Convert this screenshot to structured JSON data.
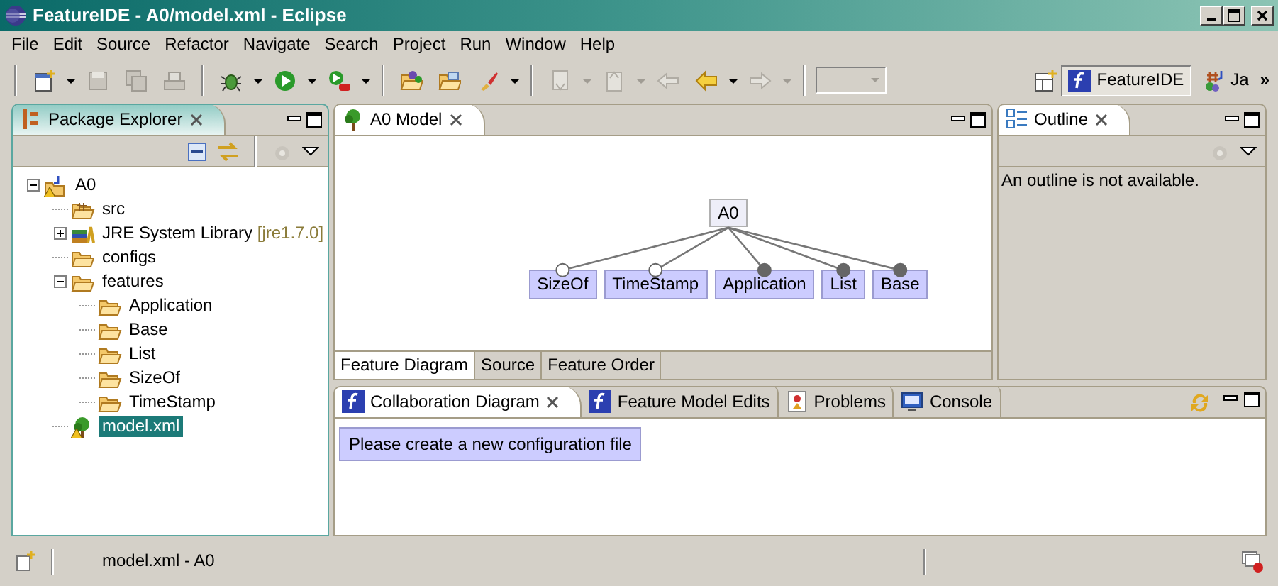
{
  "window": {
    "title": "FeatureIDE - A0/model.xml - Eclipse"
  },
  "menu": [
    "File",
    "Edit",
    "Source",
    "Refactor",
    "Navigate",
    "Search",
    "Project",
    "Run",
    "Window",
    "Help"
  ],
  "perspectives": [
    {
      "label": "FeatureIDE",
      "kind": "featureide",
      "selected": true
    },
    {
      "label": "Ja",
      "kind": "java",
      "selected": false
    }
  ],
  "perspective_overflow": "»",
  "package_explorer": {
    "title": "Package Explorer",
    "tree": [
      {
        "label": "A0",
        "kind": "project",
        "expanded": true,
        "selected": false,
        "warning": true,
        "children": [
          {
            "label": "src",
            "kind": "source",
            "selected": false,
            "warning": false
          },
          {
            "label": "JRE System Library",
            "decoration": "[jre1.7.0]",
            "kind": "library",
            "expanded": false,
            "selected": false,
            "warning": false
          },
          {
            "label": "configs",
            "kind": "folder",
            "selected": false,
            "warning": false
          },
          {
            "label": "features",
            "kind": "folder",
            "expanded": true,
            "selected": false,
            "warning": false,
            "children": [
              {
                "label": "Application",
                "kind": "folder",
                "selected": false,
                "warning": false
              },
              {
                "label": "Base",
                "kind": "folder",
                "selected": false,
                "warning": false
              },
              {
                "label": "List",
                "kind": "folder",
                "selected": false,
                "warning": false
              },
              {
                "label": "SizeOf",
                "kind": "folder",
                "selected": false,
                "warning": false
              },
              {
                "label": "TimeStamp",
                "kind": "folder",
                "selected": false,
                "warning": false
              }
            ]
          },
          {
            "label": "model.xml",
            "kind": "model",
            "selected": true,
            "warning": true
          }
        ]
      }
    ]
  },
  "editor": {
    "tabs": [
      {
        "label": "A0 Model",
        "selected": true
      }
    ],
    "diagram": {
      "root": "A0",
      "features": [
        {
          "label": "SizeOf",
          "mandatory": false
        },
        {
          "label": "TimeStamp",
          "mandatory": false
        },
        {
          "label": "Application",
          "mandatory": true
        },
        {
          "label": "List",
          "mandatory": true
        },
        {
          "label": "Base",
          "mandatory": true
        }
      ]
    },
    "pages": [
      {
        "label": "Feature Diagram",
        "selected": true
      },
      {
        "label": "Source",
        "selected": false
      },
      {
        "label": "Feature Order",
        "selected": false
      }
    ]
  },
  "outline": {
    "title": "Outline",
    "message": "An outline is not available."
  },
  "bottom": {
    "tabs": [
      {
        "label": "Collaboration Diagram",
        "kind": "featureide",
        "selected": true
      },
      {
        "label": "Feature Model Edits",
        "kind": "featureide",
        "selected": false
      },
      {
        "label": "Problems",
        "kind": "problems",
        "selected": false
      },
      {
        "label": "Console",
        "kind": "console",
        "selected": false
      }
    ],
    "message": "Please create a new configuration file"
  },
  "status_bar": {
    "text": "model.xml - A0"
  }
}
